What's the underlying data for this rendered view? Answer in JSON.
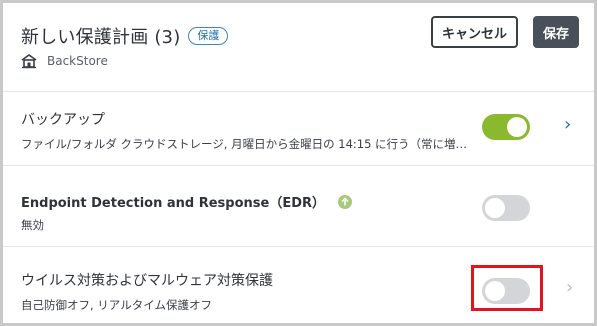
{
  "header": {
    "title": "新しい保護計画 (3)",
    "badge": "保護",
    "store_name": "BackStore",
    "cancel_label": "キャンセル",
    "save_label": "保存"
  },
  "rows": [
    {
      "title": "バックアップ",
      "description": "ファイル/フォルダ クラウドストレージ, 月曜日から金曜日の 14:15 に行う（常に増…",
      "toggle_on": true,
      "chevron": "›"
    },
    {
      "title": "Endpoint Detection and Response（EDR）",
      "description": "無効",
      "toggle_on": false,
      "chevron": ""
    },
    {
      "title": "ウイルス対策およびマルウェア対策保護",
      "description": "自己防御オフ, リアルタイム保護オフ",
      "toggle_on": false,
      "chevron": "›"
    }
  ],
  "colors": {
    "toggle_on": "#8ab82e",
    "toggle_off": "#d3d5d9",
    "highlight": "#e0151f",
    "badge": "#3b86c8"
  }
}
